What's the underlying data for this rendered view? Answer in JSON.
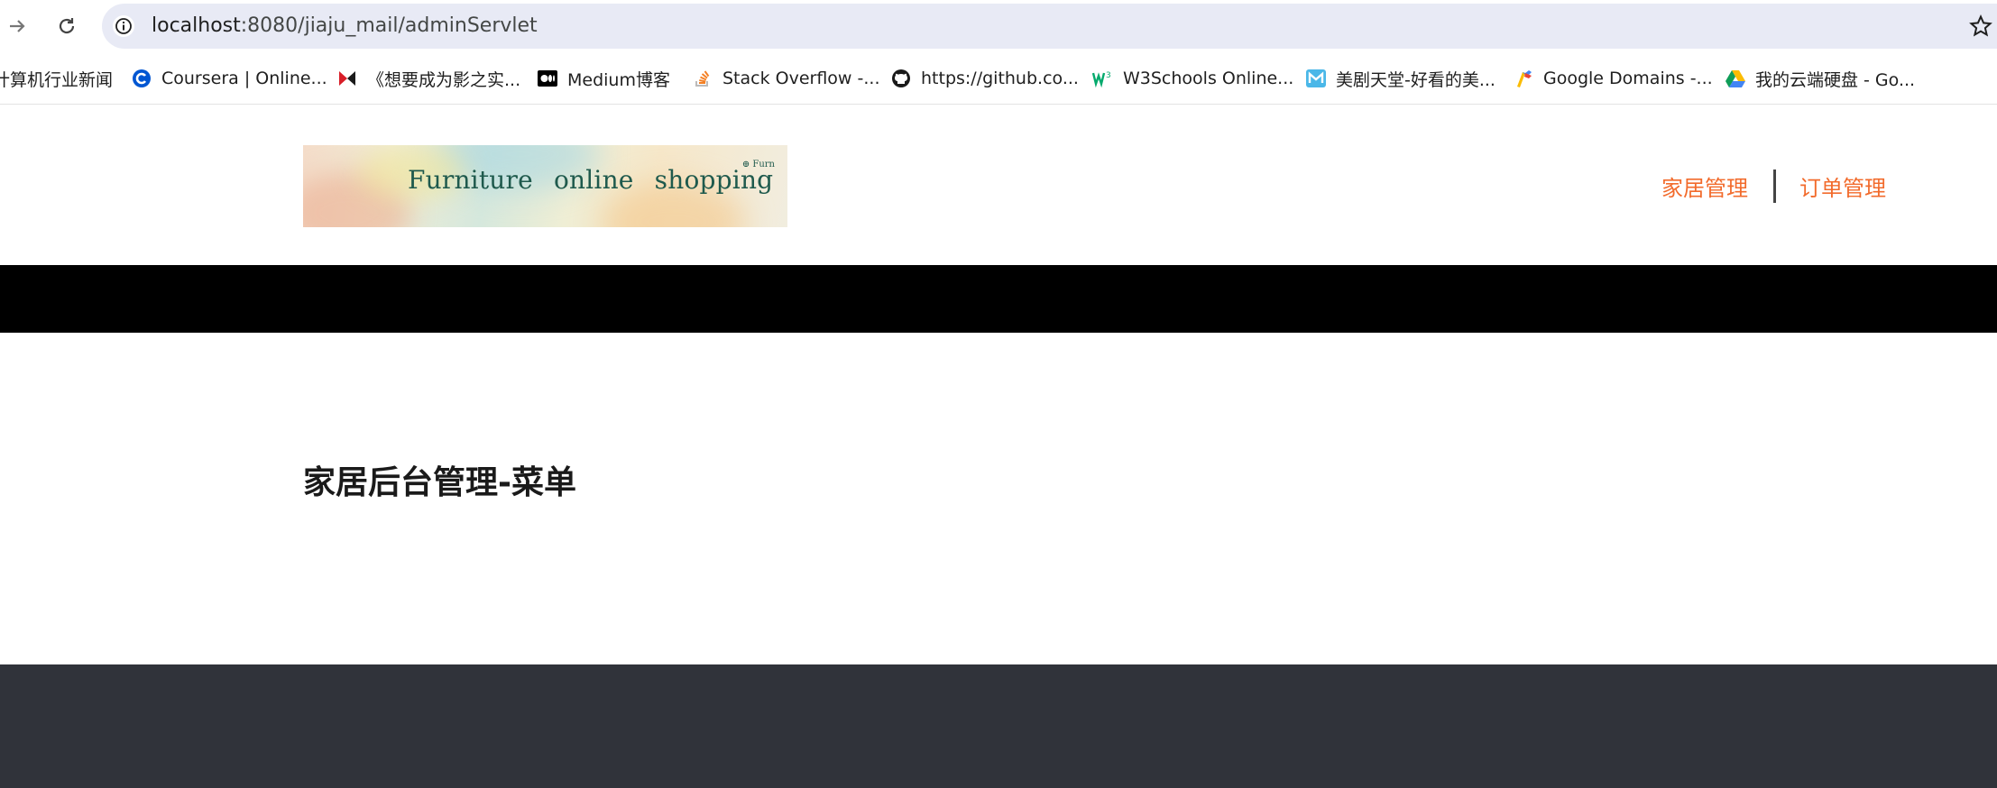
{
  "browser": {
    "url_host": "localhost",
    "url_path": ":8080/jiaju_mail/adminServlet"
  },
  "bookmarks": [
    {
      "label": "计算机行业新闻",
      "icon": "none"
    },
    {
      "label": "Coursera | Online...",
      "icon": "coursera-icon"
    },
    {
      "label": "《想要成为影之实...",
      "icon": "bilibili-icon"
    },
    {
      "label": "Medium博客",
      "icon": "medium-icon"
    },
    {
      "label": "Stack Overflow -...",
      "icon": "stackoverflow-icon"
    },
    {
      "label": "https://github.co...",
      "icon": "github-icon"
    },
    {
      "label": "W3Schools Online...",
      "icon": "w3schools-icon"
    },
    {
      "label": "美剧天堂-好看的美...",
      "icon": "meiju-icon"
    },
    {
      "label": "Google Domains -...",
      "icon": "google-domains-icon"
    },
    {
      "label": "我的云端硬盘 - Go...",
      "icon": "google-drive-icon"
    }
  ],
  "logo": {
    "text": "Furniture online shopping",
    "mark": "⊕ Furn"
  },
  "nav": {
    "furniture_mgmt": "家居管理",
    "order_mgmt": "订单管理"
  },
  "main": {
    "title": "家居后台管理-菜单"
  },
  "colors": {
    "accent": "#f26b2c",
    "footer": "#30333a",
    "omnibox": "#e8eaf5"
  }
}
